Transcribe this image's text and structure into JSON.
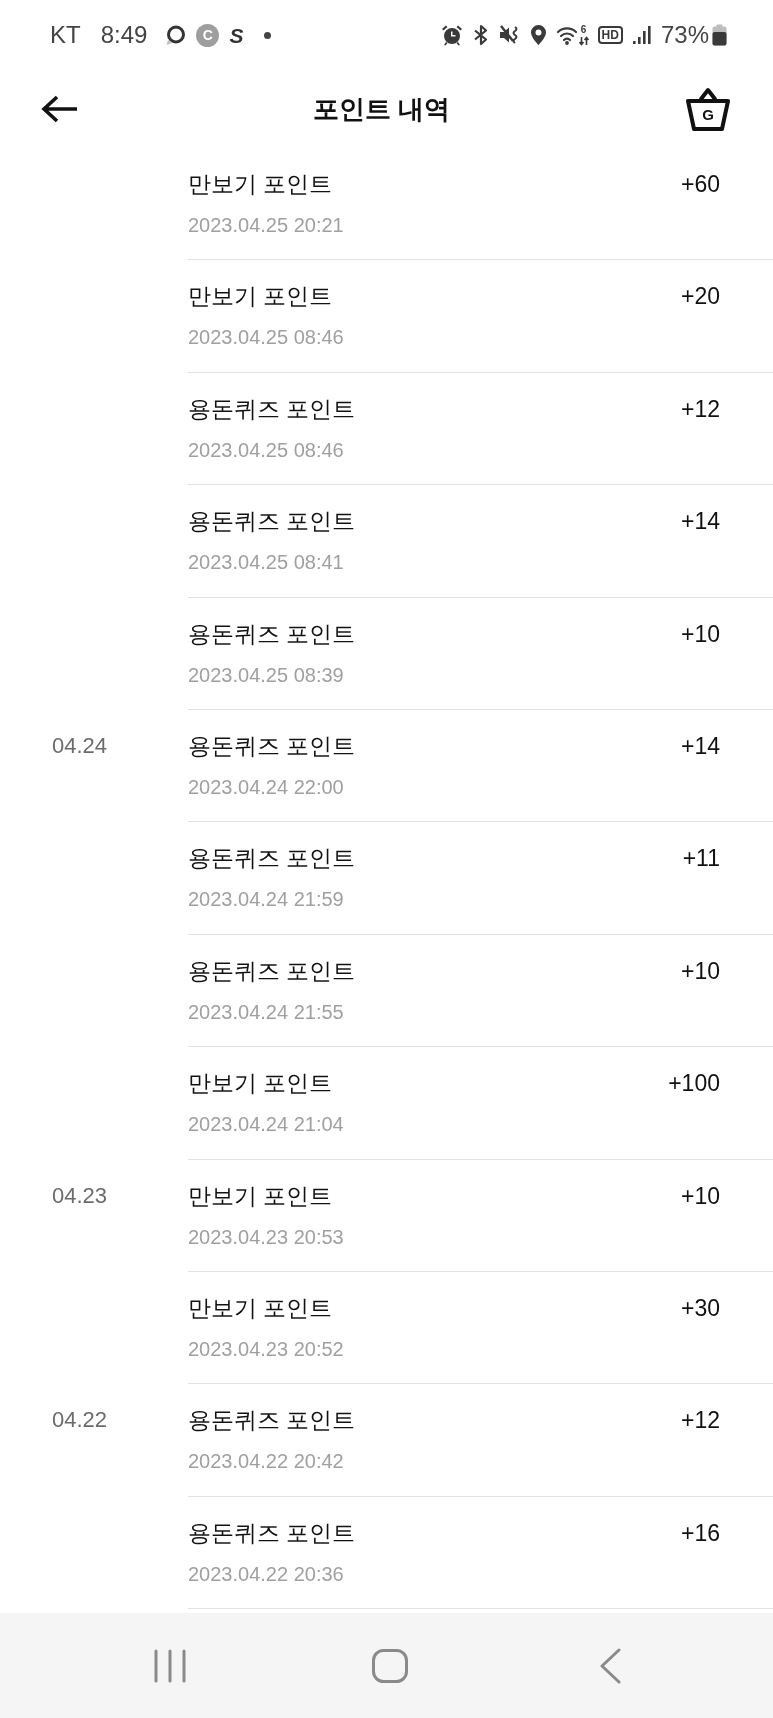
{
  "status_bar": {
    "carrier": "KT",
    "time": "8:49",
    "left_icons": [
      {
        "kind": "ring"
      },
      {
        "kind": "pin",
        "label": "C"
      },
      {
        "kind": "logo",
        "label": "S"
      },
      {
        "kind": "dot"
      }
    ],
    "right_icons": [
      {
        "kind": "alarm"
      },
      {
        "kind": "bluetooth"
      },
      {
        "kind": "mute"
      },
      {
        "kind": "location"
      },
      {
        "kind": "wifi",
        "label": "6"
      },
      {
        "kind": "hd",
        "label": "HD"
      },
      {
        "kind": "signal"
      }
    ],
    "battery": "73%"
  },
  "header": {
    "title": "포인트 내역",
    "basket_letter": "G"
  },
  "groups": [
    {
      "entries": [
        {
          "title": "만보기 포인트",
          "datetime": "2023.04.25 20:21",
          "amount": "+60"
        },
        {
          "title": "만보기 포인트",
          "datetime": "2023.04.25 08:46",
          "amount": "+20"
        },
        {
          "title": "용돈퀴즈 포인트",
          "datetime": "2023.04.25 08:46",
          "amount": "+12"
        },
        {
          "title": "용돈퀴즈 포인트",
          "datetime": "2023.04.25 08:41",
          "amount": "+14"
        },
        {
          "title": "용돈퀴즈 포인트",
          "datetime": "2023.04.25 08:39",
          "amount": "+10"
        }
      ]
    },
    {
      "date": "04.24",
      "entries": [
        {
          "title": "용돈퀴즈 포인트",
          "datetime": "2023.04.24 22:00",
          "amount": "+14"
        },
        {
          "title": "용돈퀴즈 포인트",
          "datetime": "2023.04.24 21:59",
          "amount": "+11"
        },
        {
          "title": "용돈퀴즈 포인트",
          "datetime": "2023.04.24 21:55",
          "amount": "+10"
        },
        {
          "title": "만보기 포인트",
          "datetime": "2023.04.24 21:04",
          "amount": "+100"
        }
      ]
    },
    {
      "date": "04.23",
      "entries": [
        {
          "title": "만보기 포인트",
          "datetime": "2023.04.23 20:53",
          "amount": "+10"
        },
        {
          "title": "만보기 포인트",
          "datetime": "2023.04.23 20:52",
          "amount": "+30"
        }
      ]
    },
    {
      "date": "04.22",
      "entries": [
        {
          "title": "용돈퀴즈 포인트",
          "datetime": "2023.04.22 20:42",
          "amount": "+12"
        },
        {
          "title": "용돈퀴즈 포인트",
          "datetime": "2023.04.22 20:36",
          "amount": "+16"
        }
      ]
    }
  ],
  "nav_bar": {
    "buttons": [
      {
        "kind": "recents"
      },
      {
        "kind": "home"
      },
      {
        "kind": "back"
      }
    ]
  }
}
